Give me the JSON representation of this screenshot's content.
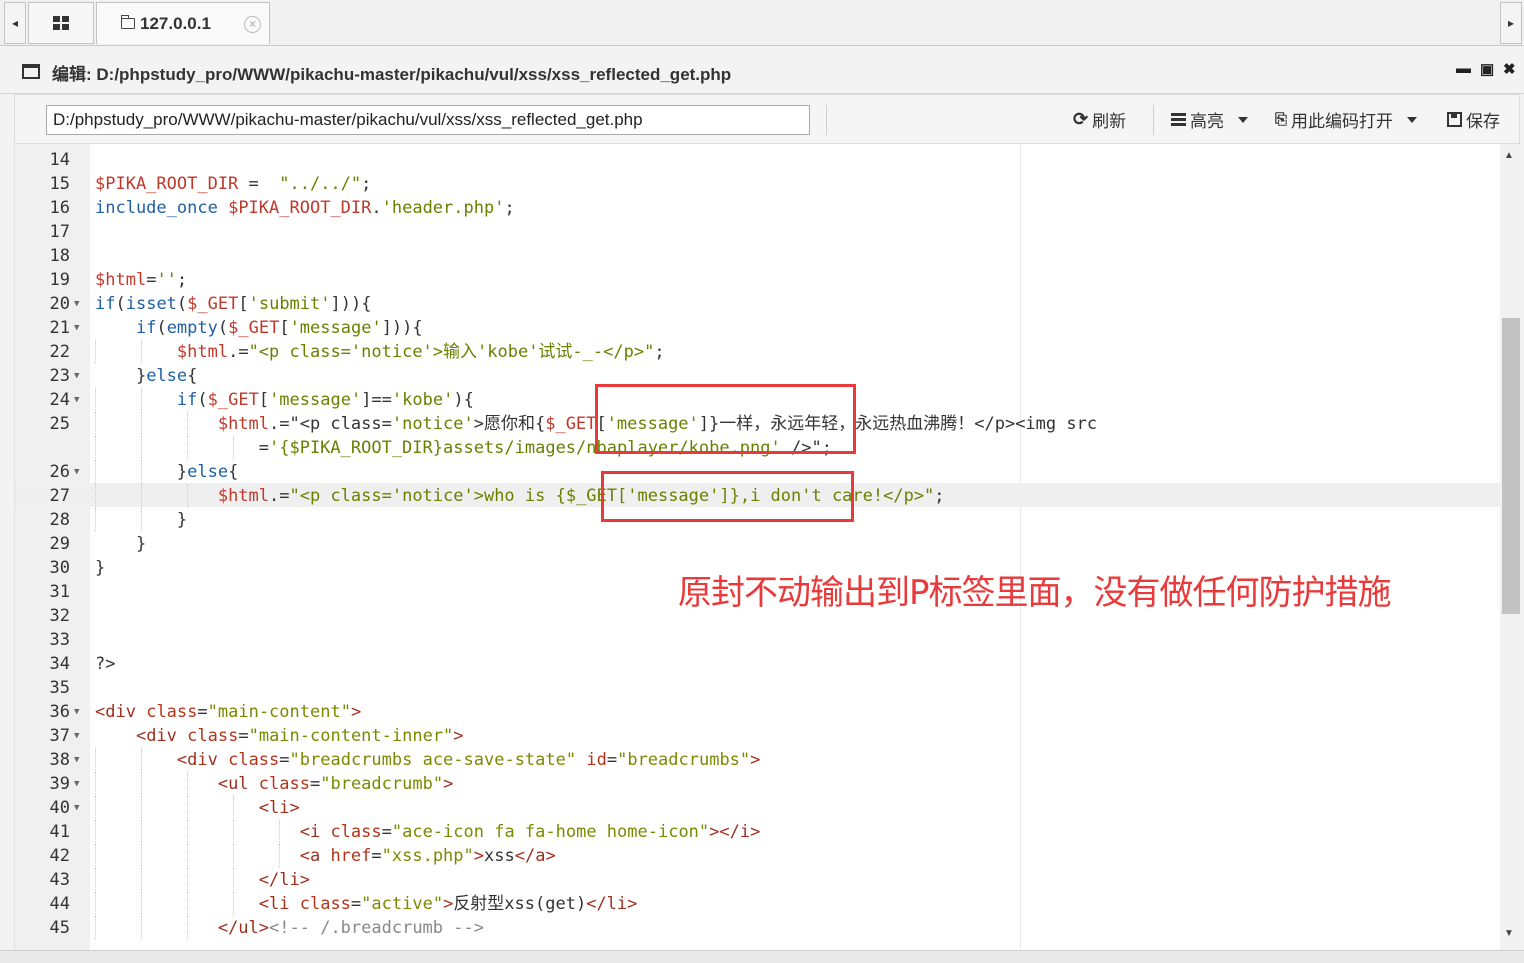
{
  "tabbar": {
    "tab_label": "127.0.0.1",
    "close_glyph": "×",
    "left_arrow": "◂",
    "right_arrow": "▸"
  },
  "window": {
    "title": "编辑: D:/phpstudy_pro/WWW/pikachu-master/pikachu/vul/xss/xss_reflected_get.php",
    "minimize": "▬",
    "restore": "▣",
    "close": "✖"
  },
  "toolbar": {
    "path_value": "D:/phpstudy_pro/WWW/pikachu-master/pikachu/vul/xss/xss_reflected_get.php",
    "refresh_label": "刷新",
    "highlight_label": "高亮",
    "open_with_encoding_label": "用此编码打开",
    "save_label": "保存"
  },
  "editor": {
    "lines": [
      {
        "n": "14",
        "text": ""
      },
      {
        "n": "15",
        "text": "$PIKA_ROOT_DIR =  \"../../\";"
      },
      {
        "n": "16",
        "text": "include_once $PIKA_ROOT_DIR.'header.php';"
      },
      {
        "n": "17",
        "text": ""
      },
      {
        "n": "18",
        "text": ""
      },
      {
        "n": "19",
        "text": "$html='';"
      },
      {
        "n": "20",
        "text": "if(isset($_GET['submit'])){"
      },
      {
        "n": "21",
        "text": "    if(empty($_GET['message'])){"
      },
      {
        "n": "22",
        "text": "        $html.=\"<p class='notice'>输入'kobe'试试-_-</p>\";"
      },
      {
        "n": "23",
        "text": "    }else{"
      },
      {
        "n": "24",
        "text": "        if($_GET['message']=='kobe'){"
      },
      {
        "n": "25",
        "text": "            $html.=\"<p class='notice'>愿你和{$_GET['message']}一样，永远年轻，永远热血沸腾！</p><img src"
      },
      {
        "n": "",
        "text": "                ='{$PIKA_ROOT_DIR}assets/images/nbaplayer/kobe.png' />\";"
      },
      {
        "n": "26",
        "text": "        }else{"
      },
      {
        "n": "27",
        "text": "            $html.=\"<p class='notice'>who is {$_GET['message']},i don't care!</p>\";"
      },
      {
        "n": "28",
        "text": "        }"
      },
      {
        "n": "29",
        "text": "    }"
      },
      {
        "n": "30",
        "text": "}"
      },
      {
        "n": "31",
        "text": ""
      },
      {
        "n": "32",
        "text": ""
      },
      {
        "n": "33",
        "text": ""
      },
      {
        "n": "34",
        "text": "?>"
      },
      {
        "n": "35",
        "text": ""
      },
      {
        "n": "36",
        "text": "<div class=\"main-content\">"
      },
      {
        "n": "37",
        "text": "    <div class=\"main-content-inner\">"
      },
      {
        "n": "38",
        "text": "        <div class=\"breadcrumbs ace-save-state\" id=\"breadcrumbs\">"
      },
      {
        "n": "39",
        "text": "            <ul class=\"breadcrumb\">"
      },
      {
        "n": "40",
        "text": "                <li>"
      },
      {
        "n": "41",
        "text": "                    <i class=\"ace-icon fa fa-home home-icon\"></i>"
      },
      {
        "n": "42",
        "text": "                    <a href=\"xss.php\">xss</a>"
      },
      {
        "n": "43",
        "text": "                </li>"
      },
      {
        "n": "44",
        "text": "                <li class=\"active\">反射型xss(get)</li>"
      },
      {
        "n": "45",
        "text": "            </ul><!-- /.breadcrumb -->"
      }
    ]
  },
  "annotation": {
    "text": "原封不动输出到P标签里面，没有做任何防护措施",
    "color": "#e83a3a"
  }
}
